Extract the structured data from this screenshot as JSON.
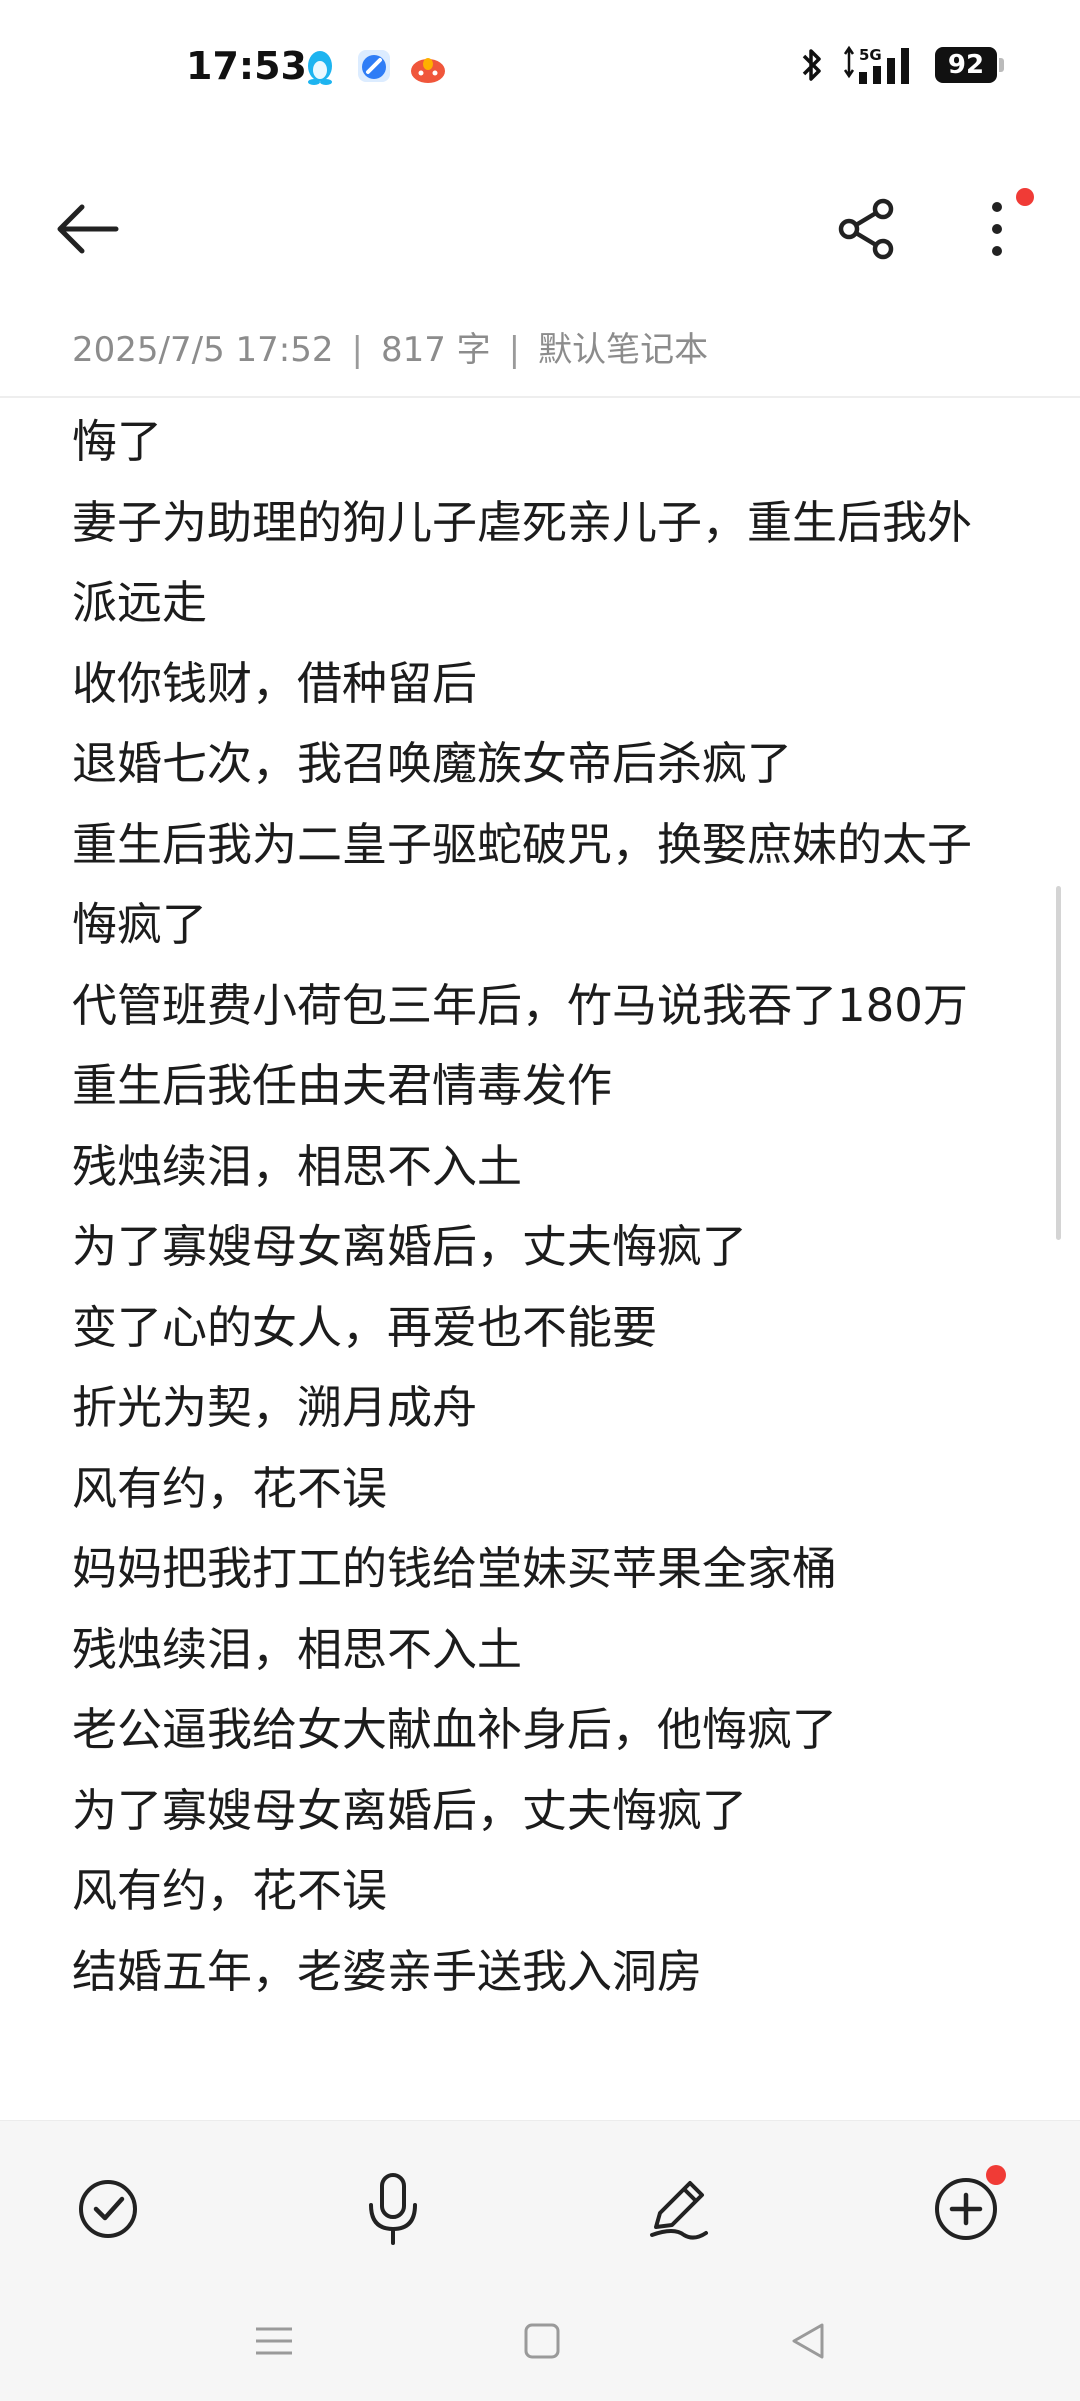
{
  "status_bar": {
    "time": "17:53",
    "network": "5G",
    "battery": "92",
    "notification_icons": [
      "qq-penguin-icon",
      "blue-app-icon",
      "red-app-icon"
    ]
  },
  "header": {
    "back_icon": "arrow-left-icon",
    "share_icon": "share-icon",
    "more_icon": "more-vertical-icon",
    "more_badge_color": "#f03b36"
  },
  "note": {
    "date": "2025/7/5 17:52",
    "word_count": "817 字",
    "notebook": "默认笔记本",
    "separator": "|",
    "paragraphs": [
      "悔了",
      "妻子为助理的狗儿子虐死亲儿子，重生后我外派远走",
      "收你钱财，借种留后",
      "退婚七次，我召唤魔族女帝后杀疯了",
      "重生后我为二皇子驱蛇破咒，换娶庶妹的太子悔疯了",
      "代管班费小荷包三年后，竹马说我吞了180万",
      "重生后我任由夫君情毒发作",
      "残烛续泪，相思不入土",
      "为了寡嫂母女离婚后，丈夫悔疯了",
      "变了心的女人，再爱也不能要",
      "折光为契，溯月成舟",
      "风有约，花不误",
      "妈妈把我打工的钱给堂妹买苹果全家桶",
      "残烛续泪，相思不入土",
      "老公逼我给女大献血补身后，他悔疯了",
      "为了寡嫂母女离婚后，丈夫悔疯了",
      "风有约，花不误",
      "结婚五年，老婆亲手送我入洞房"
    ]
  },
  "toolbar": {
    "items": [
      "checklist-icon",
      "microphone-icon",
      "pen-icon",
      "add-circle-icon"
    ],
    "badge_color": "#f03b36"
  },
  "navbar": {
    "items": [
      "menu-icon",
      "home-square-icon",
      "back-triangle-icon"
    ]
  }
}
